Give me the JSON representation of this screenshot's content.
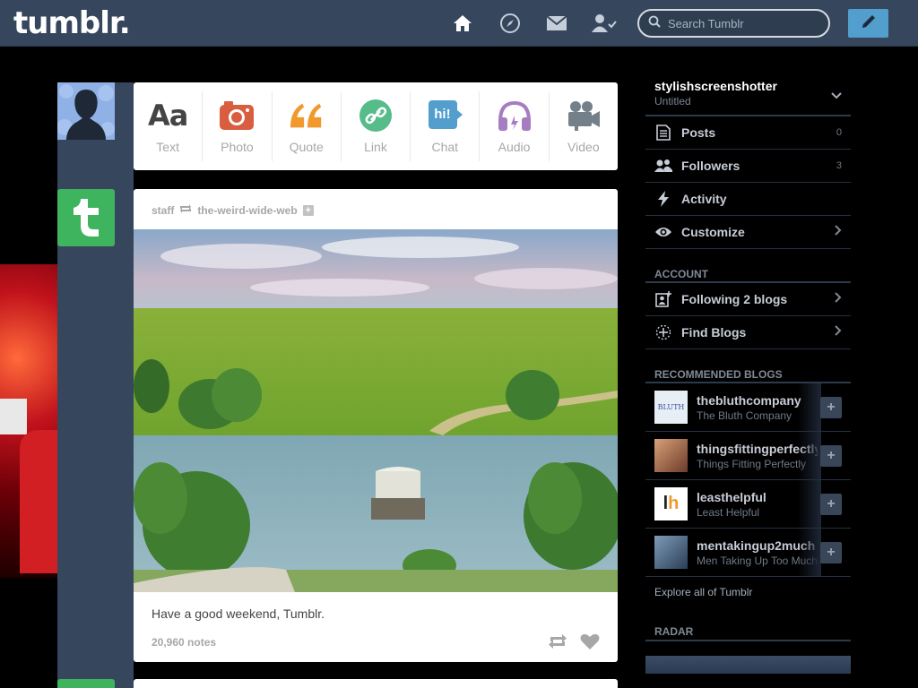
{
  "header": {
    "logo": "tumblr.",
    "search_placeholder": "Search Tumblr"
  },
  "composer": {
    "types": [
      {
        "label": "Text",
        "icon": "text-icon"
      },
      {
        "label": "Photo",
        "icon": "camera-icon"
      },
      {
        "label": "Quote",
        "icon": "quote-icon"
      },
      {
        "label": "Link",
        "icon": "link-icon"
      },
      {
        "label": "Chat",
        "icon": "chat-icon"
      },
      {
        "label": "Audio",
        "icon": "headphones-icon"
      },
      {
        "label": "Video",
        "icon": "video-camera-icon"
      }
    ],
    "text_glyph": "Aa",
    "chat_glyph": "hi!"
  },
  "post": {
    "author": "staff",
    "reblogged_from": "the-weird-wide-web",
    "caption": "Have a good weekend, Tumblr.",
    "notes": "20,960 notes"
  },
  "sidebar": {
    "blog_name": "stylishscreenshotter",
    "blog_title": "Untitled",
    "menu": [
      {
        "label": "Posts",
        "count": "0",
        "icon": "document-icon"
      },
      {
        "label": "Followers",
        "count": "3",
        "icon": "people-icon"
      },
      {
        "label": "Activity",
        "count": "",
        "icon": "lightning-icon"
      },
      {
        "label": "Customize",
        "count": "",
        "icon": "eye-icon"
      }
    ],
    "account_heading": "ACCOUNT",
    "account": [
      {
        "label": "Following 2 blogs",
        "icon": "following-icon"
      },
      {
        "label": "Find Blogs",
        "icon": "find-blogs-icon"
      }
    ],
    "recommended_heading": "RECOMMENDED BLOGS",
    "recommended": [
      {
        "name": "thebluthcompany",
        "title": "The Bluth Company",
        "avatar_color": "#e8eef6"
      },
      {
        "name": "thingsfittingperfectly",
        "title": "Things Fitting Perfectly",
        "avatar_color": "#b3583b"
      },
      {
        "name": "leasthelpful",
        "title": "Least Helpful",
        "avatar_color": "#ffffff"
      },
      {
        "name": "mentakingup2much",
        "title": "Men Taking Up Too Much",
        "avatar_color": "#4f6b8a"
      }
    ],
    "explore": "Explore all of Tumblr",
    "radar_heading": "RADAR"
  }
}
